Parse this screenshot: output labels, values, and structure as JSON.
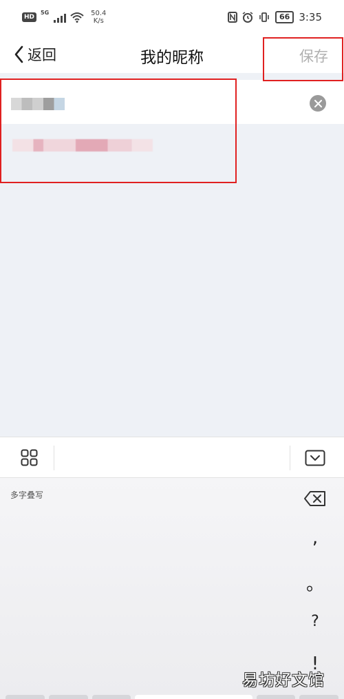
{
  "status_bar": {
    "hd": "HD",
    "network": "5G",
    "speed_value": "50.4",
    "speed_unit": "K/s",
    "battery": "66",
    "time": "3:35"
  },
  "nav": {
    "back_label": "返回",
    "title": "我的昵称",
    "save_label": "保存"
  },
  "keyboard": {
    "handwriting_label": "多字叠写",
    "keys": [
      ",",
      "。",
      "?",
      "!"
    ]
  },
  "watermark": "易坊好文馆",
  "colors": {
    "highlight": "#e02020",
    "page_bg": "#eef1f6",
    "save_disabled": "#b0b0b0"
  }
}
